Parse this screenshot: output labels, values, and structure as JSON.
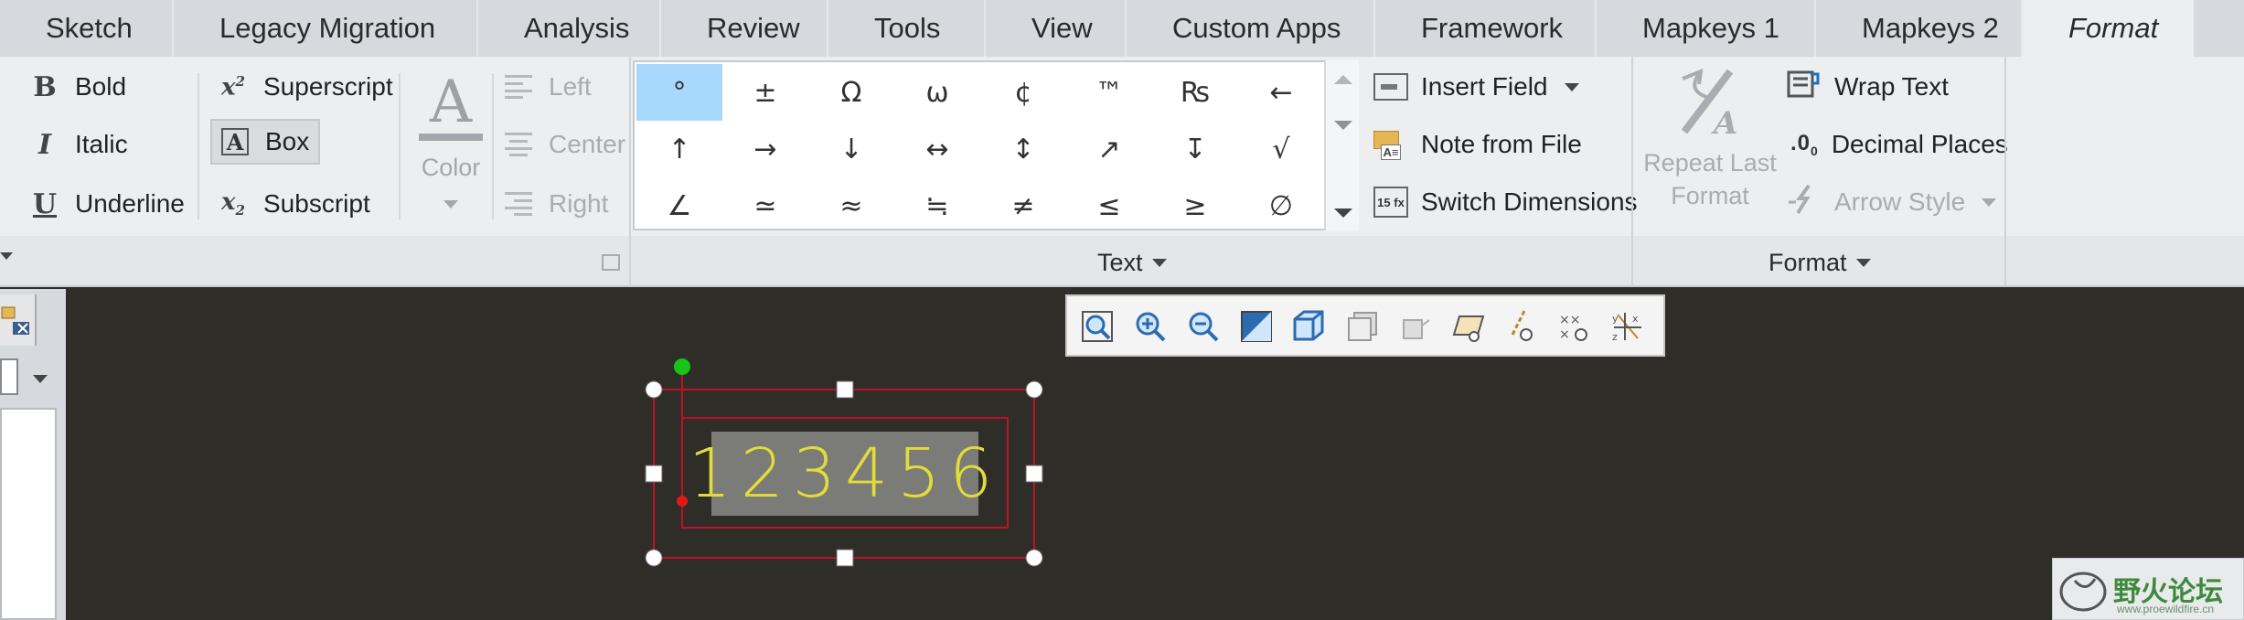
{
  "tabs": [
    "Sketch",
    "Legacy Migration",
    "Analysis",
    "Review",
    "Tools",
    "View",
    "Custom Apps",
    "Framework",
    "Mapkeys 1",
    "Mapkeys 2",
    "Format"
  ],
  "active_tab": "Format",
  "text_style": {
    "bold": "Bold",
    "italic": "Italic",
    "underline": "Underline",
    "superscript": "Superscript",
    "box": "Box",
    "subscript": "Subscript",
    "color": "Color",
    "align_left": "Left",
    "align_center": "Center",
    "align_right": "Right"
  },
  "symbols": {
    "row1": [
      "°",
      "±",
      "Ω",
      "ω",
      "¢",
      "™",
      "₨",
      "←"
    ],
    "row2": [
      "↑",
      "→",
      "↓",
      "↔",
      "↕",
      "↗",
      "↧",
      "√"
    ],
    "row3": [
      "∠",
      "≃",
      "≈",
      "≒",
      "≠",
      "≤",
      "≥",
      "∅"
    ]
  },
  "text_group": {
    "insert_field": "Insert Field",
    "note_from_file": "Note from File",
    "switch_dimensions": "Switch Dimensions",
    "label": "Text"
  },
  "format_group": {
    "repeat_last_format_line1": "Repeat Last",
    "repeat_last_format_line2": "Format",
    "wrap_text": "Wrap Text",
    "decimal_places": "Decimal Places",
    "arrow_style": "Arrow Style",
    "label": "Format"
  },
  "canvas": {
    "note_text": "123456"
  },
  "watermark": {
    "text": "野火论坛",
    "url": "www.proewildfire.cn"
  },
  "colors": {
    "canvas_bg": "#2e2d28",
    "selection_red": "#c0102a",
    "note_text_yellow": "#e1dc3a",
    "selected_symbol": "#a8d8fb"
  }
}
